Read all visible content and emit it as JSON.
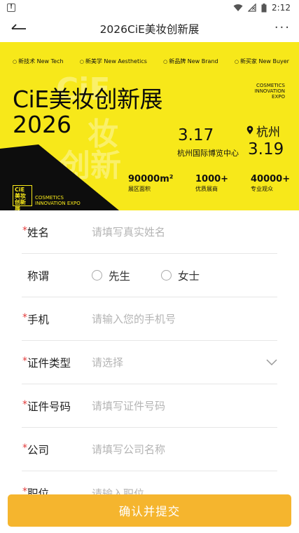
{
  "status_bar": {
    "time": "2:12",
    "warning_symbol": "!"
  },
  "header": {
    "title": "2026CiE美妆创新展",
    "more_label": "···"
  },
  "banner": {
    "tags": [
      "新技术 New Tech",
      "新美学 New Aesthetics",
      "新品牌 New Brand",
      "新买家 New Buyer"
    ],
    "title": "CiE美妆创新展",
    "year": "2026",
    "expo_en": [
      "COSMETICS",
      "INNOVATION",
      "EXPO"
    ],
    "date_start": "3.17",
    "date_end": "3.19",
    "city": "杭州",
    "venue": "杭州国际博览中心",
    "stats": [
      {
        "value": "90000m²",
        "label": "展区面积"
      },
      {
        "value": "1000+",
        "label": "优质展商"
      },
      {
        "value": "40000+",
        "label": "专业观众"
      }
    ],
    "logo_lines": [
      "CiE",
      "美妆",
      "创新展"
    ],
    "logo_caption": [
      "COSMETICS",
      "INNOVATION EXPO"
    ],
    "brand_color": "#f7e81a"
  },
  "form": {
    "required_mark": "*",
    "name": {
      "label": "姓名",
      "placeholder": "请填写真实姓名"
    },
    "salutation": {
      "label": "称谓",
      "options": [
        "先生",
        "女士"
      ]
    },
    "phone": {
      "label": "手机",
      "placeholder": "请输入您的手机号"
    },
    "id_type": {
      "label": "证件类型",
      "placeholder": "请选择"
    },
    "id_number": {
      "label": "证件号码",
      "placeholder": "请填写证件号码"
    },
    "company": {
      "label": "公司",
      "placeholder": "请填写公司名称"
    },
    "position": {
      "label": "职位",
      "placeholder": "请输入职位"
    }
  },
  "submit": {
    "label": "确认并提交",
    "color": "#f5b52e"
  }
}
